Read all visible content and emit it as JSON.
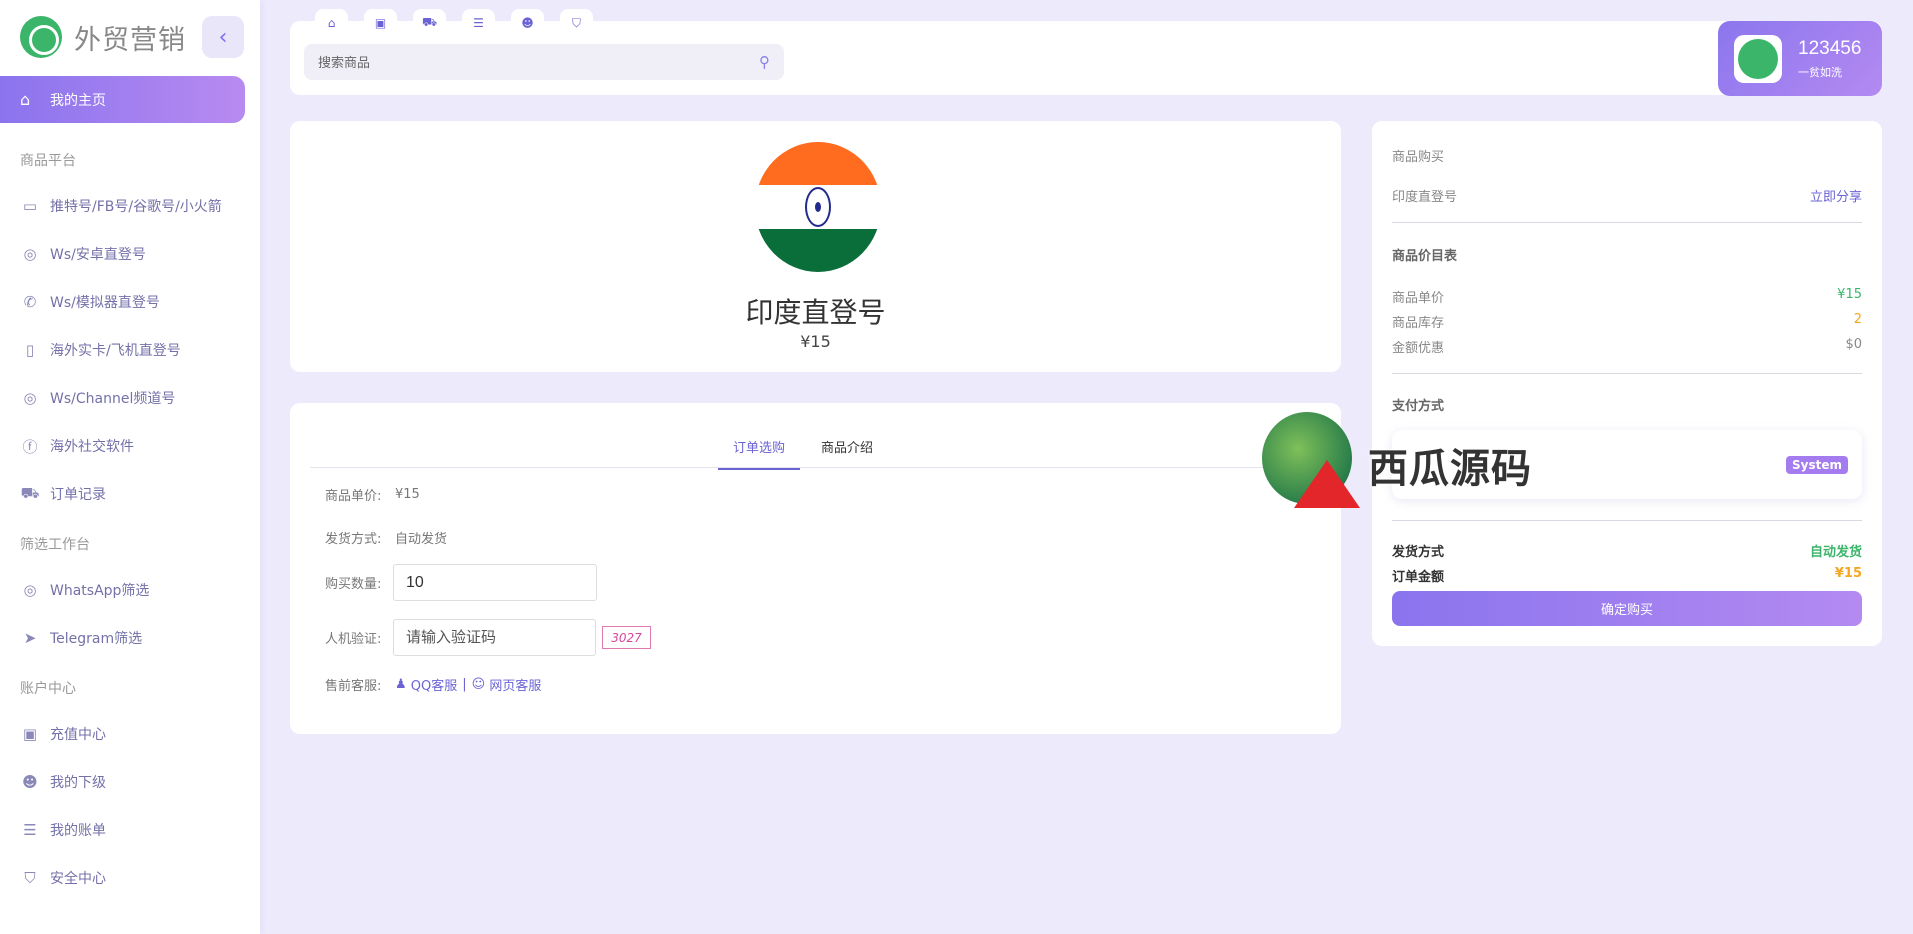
{
  "brand": {
    "name": "外贸营销",
    "collapse_icon": "chevron-left-icon"
  },
  "sidebar": {
    "home_label": "我的主页",
    "sections": [
      {
        "title": "商品平台",
        "items": [
          "推特号/FB号/谷歌号/小火箭",
          "Ws/安卓直登号",
          "Ws/模拟器直登号",
          "海外实卡/飞机直登号",
          "Ws/Channel频道号",
          "海外社交软件",
          "订单记录"
        ]
      },
      {
        "title": "筛选工作台",
        "items": [
          "WhatsApp筛选",
          "Telegram筛选"
        ]
      },
      {
        "title": "账户中心",
        "items": [
          "充值中心",
          "我的下级",
          "我的账单",
          "安全中心"
        ]
      }
    ]
  },
  "header": {
    "search_placeholder": "搜索商品",
    "user": {
      "name": "123456",
      "subtitle": "一贫如洗"
    }
  },
  "product": {
    "title": "印度直登号",
    "price": "¥15"
  },
  "order": {
    "tabs": [
      "订单选购",
      "商品介绍"
    ],
    "unit_price_label": "商品单价:",
    "unit_price_value": "¥15",
    "shipping_label": "发货方式:",
    "shipping_value": "自动发货",
    "quantity_label": "购买数量:",
    "quantity_value": "10",
    "captcha_label": "人机验证:",
    "captcha_placeholder": "请输入验证码",
    "captcha_code": "3027",
    "service_label": "售前客服:",
    "service_qq": "QQ客服",
    "service_sep": "|",
    "service_web": "网页客服"
  },
  "purchase": {
    "section_title": "商品购买",
    "product_name": "印度直登号",
    "share_label": "立即分享",
    "price_table_title": "商品价目表",
    "unit_price_label": "商品单价",
    "unit_price_value": "¥15",
    "stock_label": "商品库存",
    "stock_value": "2",
    "discount_label": "金额优惠",
    "discount_value": "$0",
    "payment_title": "支付方式",
    "payment_badge": "System",
    "shipping_label": "发货方式",
    "shipping_value": "自动发货",
    "total_label": "订单金额",
    "total_value": "¥15",
    "buy_button": "确定购买"
  },
  "watermark": {
    "text": "西瓜源码"
  },
  "colors": {
    "accent": "#6b63d4",
    "gradient_start": "#8a74ee",
    "gradient_end": "#b48af1",
    "green": "#3bb56a",
    "orange": "#f5a623"
  }
}
